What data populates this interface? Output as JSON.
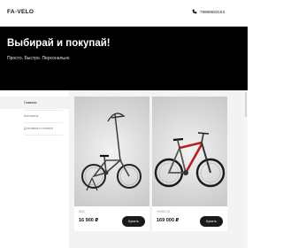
{
  "header": {
    "logo": "FA-VELO",
    "phone": "79998683163",
    "phone_icon": "phone-icon"
  },
  "hero": {
    "title": "Выбирай и покупай!",
    "subtitle": "Просто. Быстро. Персонально"
  },
  "sidebar": {
    "items": [
      {
        "label": "Главная",
        "active": true
      },
      {
        "label": "Контакты",
        "active": false
      },
      {
        "label": "Доставка и оплата",
        "active": false
      }
    ]
  },
  "products": [
    {
      "name": "BMX",
      "price": "16 900 ₽",
      "button": "Купить",
      "image": "bmx-bike-image"
    },
    {
      "name": "VIKING 29",
      "price": "169 000 ₽",
      "button": "Купить",
      "image": "mountain-bike-image"
    }
  ],
  "colors": {
    "hero_bg": "#000000",
    "accent_button": "#1a1a1a",
    "bike_red": "#b22222"
  }
}
